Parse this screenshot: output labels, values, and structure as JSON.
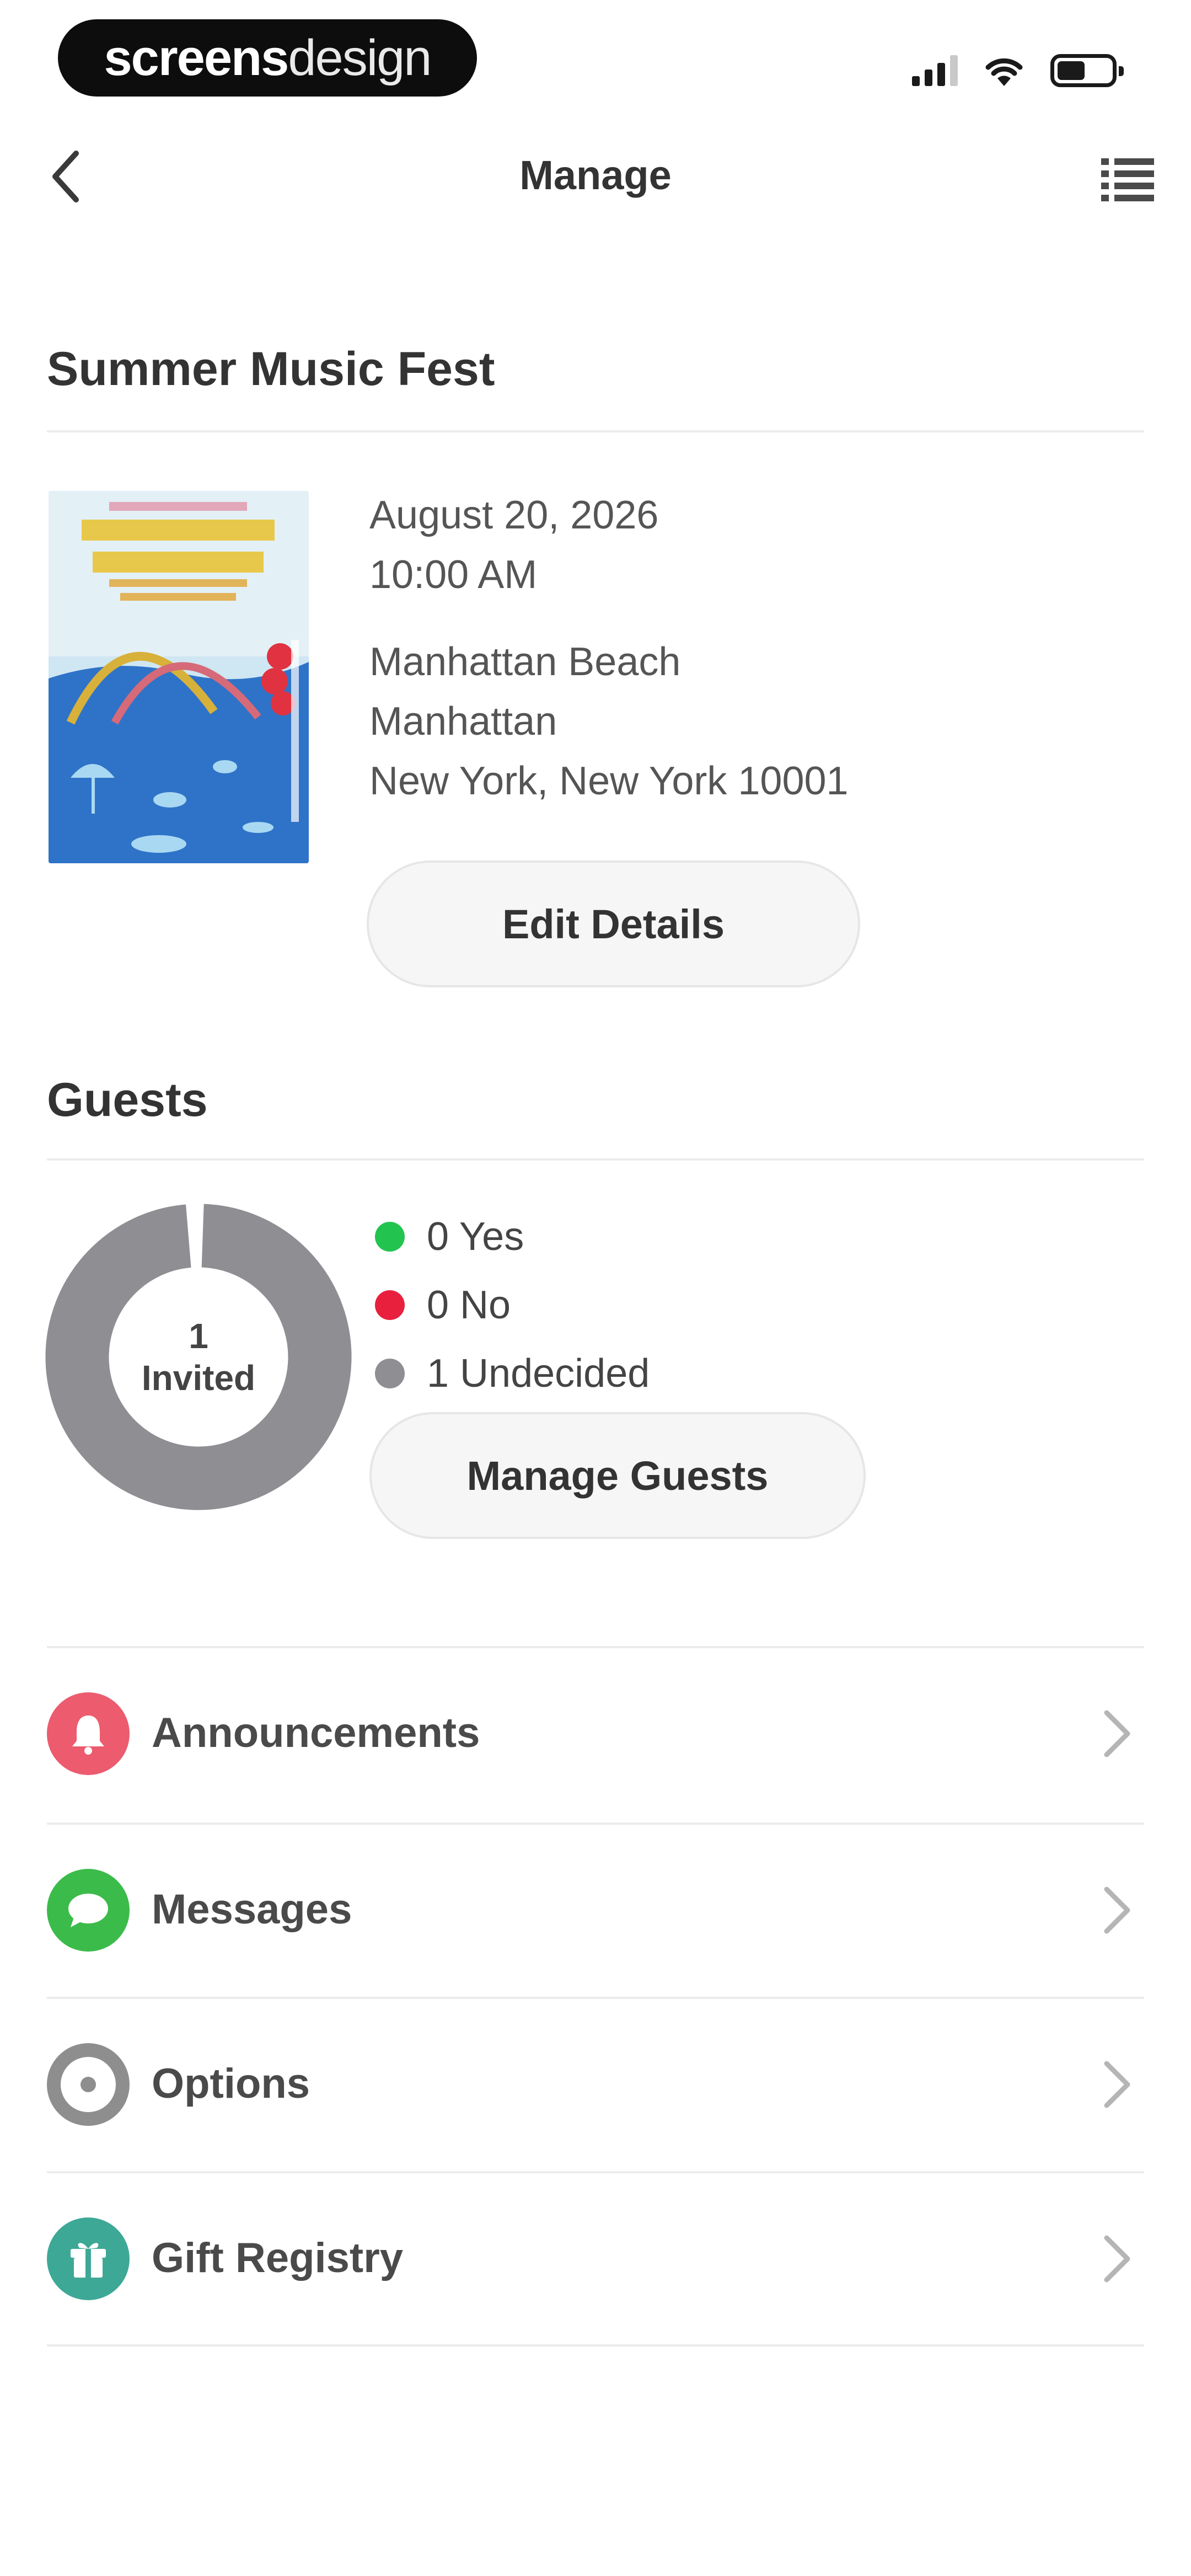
{
  "status_bar": {
    "brand_bold": "screens",
    "brand_light": "design"
  },
  "nav": {
    "title": "Manage",
    "back_icon": "chevron-left-icon",
    "menu_icon": "list-menu-icon"
  },
  "event": {
    "title": "Summer Music Fest",
    "date": "August 20, 2026",
    "time": "10:00 AM",
    "venue": "Manhattan Beach",
    "area": "Manhattan",
    "city_line": "New York, New York 10001",
    "edit_button": "Edit Details"
  },
  "guests": {
    "title": "Guests",
    "invited_count": "1",
    "invited_label": "Invited",
    "legend": [
      {
        "label": "0 Yes",
        "color": "#22c44f"
      },
      {
        "label": "0 No",
        "color": "#e8203e"
      },
      {
        "label": "1 Undecided",
        "color": "#8e8e93"
      }
    ],
    "ring_color": "#8e8e93",
    "manage_button": "Manage Guests"
  },
  "menu_items": [
    {
      "label": "Announcements",
      "icon": "bell-icon",
      "color": "#ec5b6e"
    },
    {
      "label": "Messages",
      "icon": "chat-bubble-icon",
      "color": "#3bbb4a"
    },
    {
      "label": "Options",
      "icon": "target-icon",
      "color": "#8e8e8e"
    },
    {
      "label": "Gift Registry",
      "icon": "gift-icon",
      "color": "#3ea896"
    }
  ]
}
